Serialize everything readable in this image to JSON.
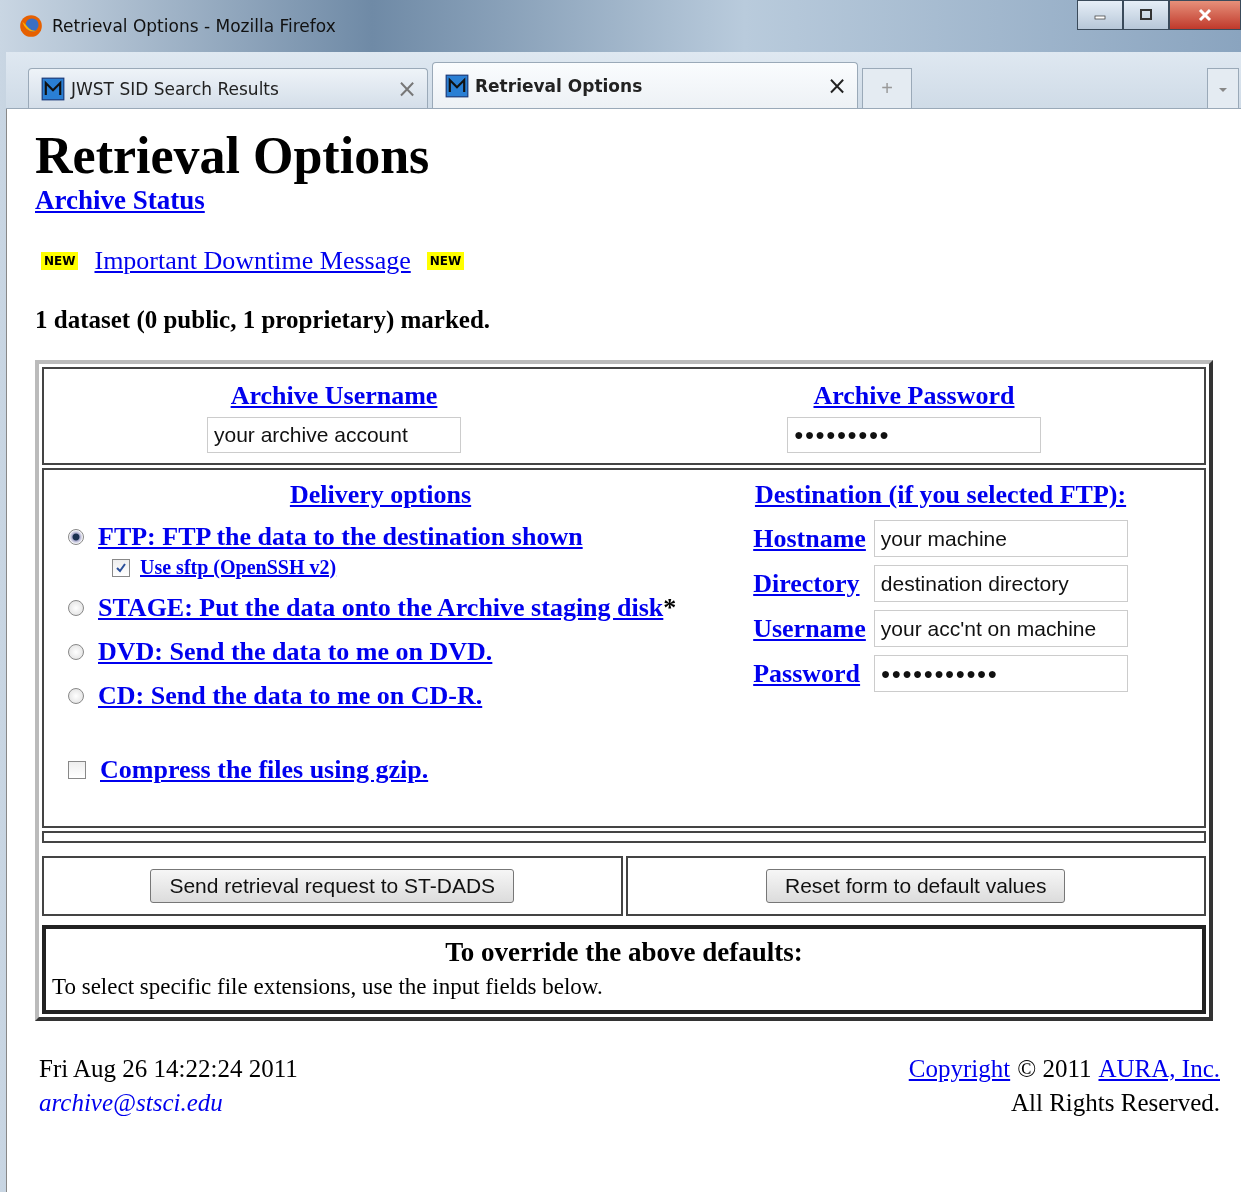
{
  "window": {
    "title": "Retrieval Options - Mozilla Firefox"
  },
  "tabs": [
    {
      "label": "JWST SID Search Results",
      "selected": false,
      "close": "×"
    },
    {
      "label": "Retrieval Options",
      "selected": true,
      "close": "×"
    }
  ],
  "new_tab": "+",
  "page": {
    "heading": "Retrieval Options",
    "status_link": "Archive Status",
    "badges": [
      "NEW",
      "NEW"
    ],
    "downtime_link": "Important Downtime Message",
    "summary": "1 dataset (0 public, 1 proprietary) marked."
  },
  "account": [
    {
      "label": "Archive Username",
      "value": "your archive account"
    },
    {
      "label": "Archive Password",
      "value": "●●●●●●●●●"
    }
  ],
  "delivery": {
    "heading": "Delivery options",
    "options": [
      {
        "label": "FTP: FTP the data to the destination shown",
        "selected": true,
        "sub_option": {
          "label": "Use sftp (OpenSSH v2)",
          "checked": true
        }
      },
      {
        "label": "STAGE: Put the data onto the Archive staging disk",
        "selected": false,
        "suffix": "*"
      },
      {
        "label": "DVD: Send the data to me on DVD.",
        "selected": false
      },
      {
        "label": "CD: Send the data to me on CD-R.",
        "selected": false
      }
    ],
    "compress": {
      "label": "Compress the files using gzip.",
      "checked": false
    }
  },
  "destination": {
    "heading": "Destination (if you selected FTP):",
    "fields": [
      {
        "label": "Hostname",
        "value": "your machine"
      },
      {
        "label": "Directory",
        "value": "destination directory"
      },
      {
        "label": "Username",
        "value": "your acc'nt on machine"
      },
      {
        "label": "Password",
        "value": "●●●●●●●●●●●"
      }
    ]
  },
  "buttons": [
    "Send retrieval request to ST-DADS",
    "Reset form to default values"
  ],
  "override": {
    "heading": "To override the above defaults:",
    "text": "To select specific file extensions, use the input fields below."
  },
  "footer": {
    "date": "Fri Aug 26 14:22:24 2011",
    "email": "archive@stsci.edu",
    "copyright_link": "Copyright",
    "year": "© 2011",
    "org_link": "AURA, Inc.",
    "rights": "All Rights Reserved."
  }
}
